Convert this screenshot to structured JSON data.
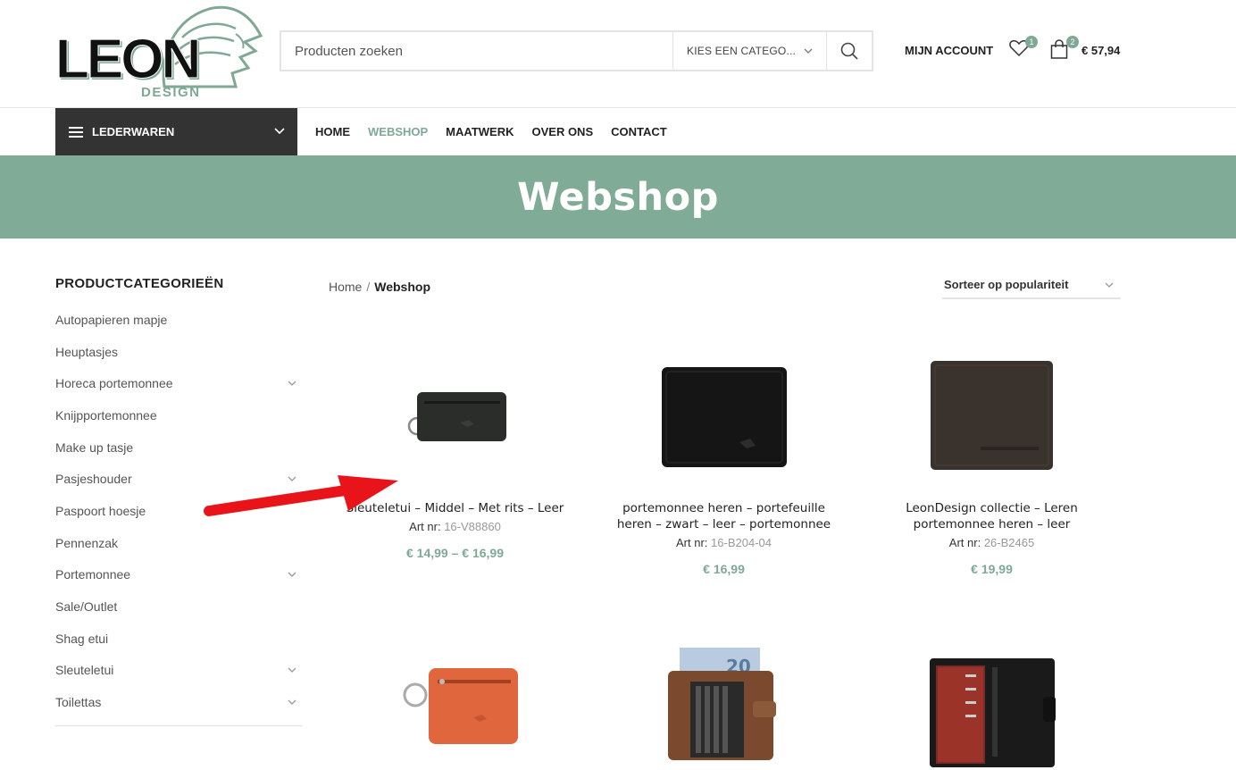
{
  "brand": {
    "logo_text": "LEON",
    "logo_sub": "DESIGN",
    "accent": "#80ab96"
  },
  "search": {
    "placeholder": "Producten zoeken",
    "category_label": "KIES EEN CATEGO..."
  },
  "header": {
    "account_label": "MIJN ACCOUNT",
    "wishlist_count": "1",
    "cart_count": "2",
    "cart_total": "€ 57,94"
  },
  "nav": {
    "categories_label": "LEDERWAREN",
    "items": [
      "HOME",
      "WEBSHOP",
      "MAATWERK",
      "OVER ONS",
      "CONTACT"
    ],
    "active": "WEBSHOP"
  },
  "page": {
    "title": "Webshop"
  },
  "sidebar": {
    "title": "PRODUCTCATEGORIEËN",
    "items": [
      {
        "label": "Autopapieren mapje",
        "expandable": false
      },
      {
        "label": "Heuptasjes",
        "expandable": false
      },
      {
        "label": "Horeca portemonnee",
        "expandable": true
      },
      {
        "label": "Knijpportemonnee",
        "expandable": false
      },
      {
        "label": "Make up tasje",
        "expandable": false
      },
      {
        "label": "Pasjeshouder",
        "expandable": true
      },
      {
        "label": "Paspoort hoesje",
        "expandable": false
      },
      {
        "label": "Pennenzak",
        "expandable": false
      },
      {
        "label": "Portemonnee",
        "expandable": true
      },
      {
        "label": "Sale/Outlet",
        "expandable": false
      },
      {
        "label": "Shag etui",
        "expandable": false
      },
      {
        "label": "Sleuteletui",
        "expandable": true
      },
      {
        "label": "Toilettas",
        "expandable": true
      }
    ]
  },
  "breadcrumb": {
    "home": "Home",
    "separator": "/",
    "current": "Webshop"
  },
  "sort": {
    "selected": "Sorteer op populariteit"
  },
  "products": [
    {
      "name": "Sleuteletui – Middel – Met rits – Leer",
      "art_label": "Art nr:",
      "art_nr": "16-V88860",
      "price": "€ 14,99 – € 16,99",
      "image": "black-key-pouch"
    },
    {
      "name": "portemonnee heren – portefeuille heren – zwart – leer – portemonnee",
      "art_label": "Art nr:",
      "art_nr": "16-B204-04",
      "price": "€ 16,99",
      "image": "black-wallet"
    },
    {
      "name": "LeonDesign collectie – Leren portemonnee heren – leer",
      "art_label": "Art nr:",
      "art_nr": "26-B2465",
      "price": "€ 19,99",
      "image": "brown-wallet"
    },
    {
      "name": "",
      "image": "orange-key-pouch"
    },
    {
      "name": "",
      "image": "brown-card-wallet"
    },
    {
      "name": "",
      "image": "black-open-wallet"
    }
  ],
  "annotation": {
    "arrow_color": "#e8141a"
  }
}
